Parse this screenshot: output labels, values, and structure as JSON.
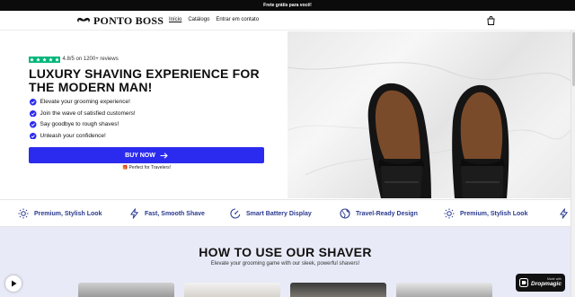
{
  "announcement": "Frete grátis para você!",
  "header": {
    "logo_text": "PONTO BOSS",
    "nav": [
      "Início",
      "Catálogo",
      "Entrar em contato"
    ]
  },
  "hero": {
    "rating_text": "4.8/5 on 1200+ reviews",
    "rating_stars": 5,
    "headline": "LUXURY SHAVING EXPERIENCE FOR THE MODERN MAN!",
    "bullets": [
      "Elevate your grooming experience!",
      "Join the wave of satisfied customers!",
      "Say goodbye to rough shaves!",
      "Unleash your confidence!"
    ],
    "buy_label": "BUY NOW",
    "perfect_text": "🎁 Perfect for Travelers!"
  },
  "features": [
    {
      "label": "Premium, Stylish Look",
      "icon": "sun-icon"
    },
    {
      "label": "Fast, Smooth Shave",
      "icon": "bolt-icon"
    },
    {
      "label": "Smart Battery Display",
      "icon": "gauge-icon"
    },
    {
      "label": "Travel-Ready Design",
      "icon": "globe-icon"
    },
    {
      "label": "Premium, Stylish Look",
      "icon": "sun-icon"
    }
  ],
  "howto": {
    "title": "HOW TO USE OUR SHAVER",
    "subtitle": "Elevate your grooming game with our sleek, powerful shavers!"
  },
  "badge": {
    "small": "Made with",
    "big": "Dropmagic"
  },
  "colors": {
    "accent": "#2b2bef",
    "feature_text": "#2a3a8f",
    "trust_green": "#00b67a",
    "howto_bg": "#e8eaf7"
  }
}
